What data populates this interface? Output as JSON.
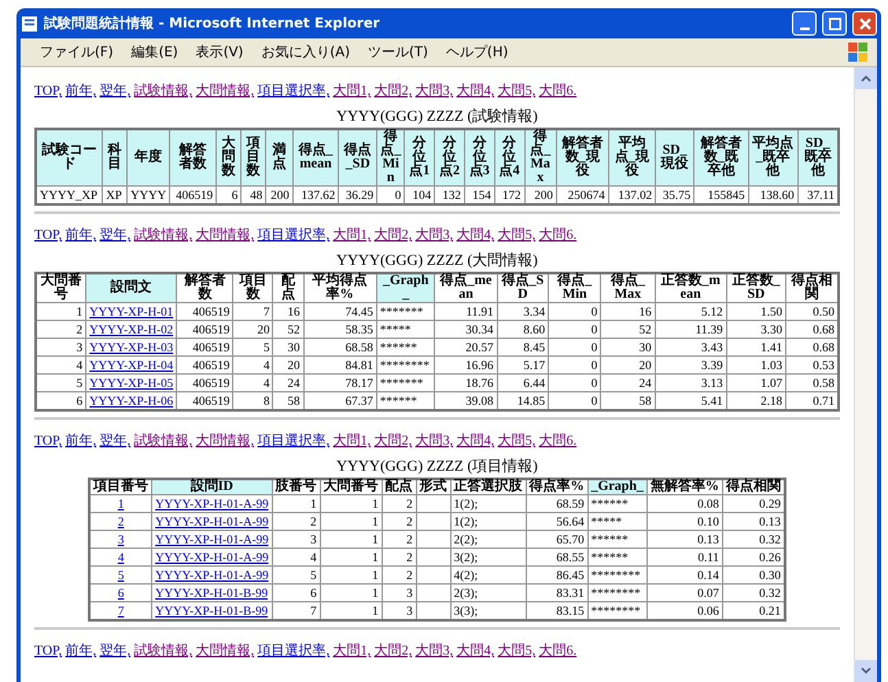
{
  "window": {
    "title": "試験問題統計情報 - Microsoft Internet Explorer"
  },
  "menu": [
    "ファイル(F)",
    "編集(E)",
    "表示(V)",
    "お気に入り(A)",
    "ツール(T)",
    "ヘルプ(H)"
  ],
  "sections": [
    {
      "nav": [
        {
          "text": "TOP,",
          "visited": false
        },
        {
          "text": "前年,",
          "visited": false
        },
        {
          "text": "翌年,",
          "visited": false
        },
        {
          "text": "試験情報,",
          "visited": true
        },
        {
          "text": "大問情報,",
          "visited": true
        },
        {
          "text": "項目選択率,",
          "visited": false
        },
        {
          "text": "大問1,",
          "visited": true
        },
        {
          "text": "大問2,",
          "visited": true
        },
        {
          "text": "大問3,",
          "visited": true
        },
        {
          "text": "大問4,",
          "visited": true
        },
        {
          "text": "大問5,",
          "visited": true
        },
        {
          "text": "大問6.",
          "visited": true
        }
      ],
      "caption": "YYYY(GGG) ZZZZ (試験情報)",
      "table": {
        "columns": [
          {
            "label": "試験コード",
            "highlighted": true,
            "kind": "text"
          },
          {
            "label": "科目",
            "highlighted": true,
            "kind": "text"
          },
          {
            "label": "年度",
            "highlighted": true,
            "kind": "text"
          },
          {
            "label": "解答者数",
            "highlighted": true,
            "kind": "number"
          },
          {
            "label": "大問数",
            "highlighted": true,
            "kind": "number"
          },
          {
            "label": "項目数",
            "highlighted": true,
            "kind": "number"
          },
          {
            "label": "満点",
            "highlighted": true,
            "kind": "number"
          },
          {
            "label": "得点_mean",
            "highlighted": true,
            "kind": "number"
          },
          {
            "label": "得点_SD",
            "highlighted": true,
            "kind": "number"
          },
          {
            "label": "得点_Min",
            "highlighted": true,
            "kind": "number"
          },
          {
            "label": "分位点1",
            "highlighted": true,
            "kind": "number"
          },
          {
            "label": "分位点2",
            "highlighted": true,
            "kind": "number"
          },
          {
            "label": "分位点3",
            "highlighted": true,
            "kind": "number"
          },
          {
            "label": "分位点4",
            "highlighted": true,
            "kind": "number"
          },
          {
            "label": "得点_Max",
            "highlighted": true,
            "kind": "number"
          },
          {
            "label": "解答者数_現役",
            "highlighted": true,
            "kind": "number"
          },
          {
            "label": "平均点_現役",
            "highlighted": true,
            "kind": "number"
          },
          {
            "label": "SD_現役",
            "highlighted": true,
            "kind": "number"
          },
          {
            "label": "解答者数_既卒他",
            "highlighted": true,
            "kind": "number"
          },
          {
            "label": "平均点_既卒他",
            "highlighted": true,
            "kind": "number"
          },
          {
            "label": "SD_既卒他",
            "highlighted": true,
            "kind": "number"
          }
        ],
        "rows": [
          [
            "YYYY_XP",
            "XP",
            "YYYY",
            "406519",
            "6",
            "48",
            "200",
            "137.62",
            "36.29",
            "0",
            "104",
            "132",
            "154",
            "172",
            "200",
            "250674",
            "137.02",
            "35.75",
            "155845",
            "138.60",
            "37.11"
          ]
        ]
      }
    },
    {
      "nav": [
        {
          "text": "TOP,",
          "visited": false
        },
        {
          "text": "前年,",
          "visited": false
        },
        {
          "text": "翌年,",
          "visited": false
        },
        {
          "text": "試験情報,",
          "visited": true
        },
        {
          "text": "大問情報,",
          "visited": true
        },
        {
          "text": "項目選択率,",
          "visited": false
        },
        {
          "text": "大問1,",
          "visited": true
        },
        {
          "text": "大問2,",
          "visited": true
        },
        {
          "text": "大問3,",
          "visited": true
        },
        {
          "text": "大問4,",
          "visited": true
        },
        {
          "text": "大問5,",
          "visited": true
        },
        {
          "text": "大問6.",
          "visited": true
        }
      ],
      "caption": "YYYY(GGG) ZZZZ (大問情報)",
      "table": {
        "columns": [
          {
            "label": "大問番号",
            "highlighted": false,
            "kind": "number"
          },
          {
            "label": "設問文",
            "highlighted": true,
            "kind": "link"
          },
          {
            "label": "解答者数",
            "highlighted": false,
            "kind": "number"
          },
          {
            "label": "項目数",
            "highlighted": false,
            "kind": "number"
          },
          {
            "label": "配点",
            "highlighted": false,
            "kind": "number"
          },
          {
            "label": "平均得点率%",
            "highlighted": false,
            "kind": "number"
          },
          {
            "label": "_Graph_",
            "highlighted": true,
            "kind": "text"
          },
          {
            "label": "得点_mean",
            "highlighted": false,
            "kind": "number"
          },
          {
            "label": "得点_SD",
            "highlighted": false,
            "kind": "number"
          },
          {
            "label": "得点_Min",
            "highlighted": false,
            "kind": "number"
          },
          {
            "label": "得点_Max",
            "highlighted": false,
            "kind": "number"
          },
          {
            "label": "正答数_mean",
            "highlighted": false,
            "kind": "number"
          },
          {
            "label": "正答数_SD",
            "highlighted": false,
            "kind": "number"
          },
          {
            "label": "得点相関",
            "highlighted": false,
            "kind": "number"
          }
        ],
        "rows": [
          [
            "1",
            "YYYY-XP-H-01",
            "406519",
            "7",
            "16",
            "74.45",
            "*******",
            "11.91",
            "3.34",
            "0",
            "16",
            "5.12",
            "1.50",
            "0.50"
          ],
          [
            "2",
            "YYYY-XP-H-02",
            "406519",
            "20",
            "52",
            "58.35",
            "*****",
            "30.34",
            "8.60",
            "0",
            "52",
            "11.39",
            "3.30",
            "0.68"
          ],
          [
            "3",
            "YYYY-XP-H-03",
            "406519",
            "5",
            "30",
            "68.58",
            "******",
            "20.57",
            "8.45",
            "0",
            "30",
            "3.43",
            "1.41",
            "0.68"
          ],
          [
            "4",
            "YYYY-XP-H-04",
            "406519",
            "4",
            "20",
            "84.81",
            "********",
            "16.96",
            "5.17",
            "0",
            "20",
            "3.39",
            "1.03",
            "0.53"
          ],
          [
            "5",
            "YYYY-XP-H-05",
            "406519",
            "4",
            "24",
            "78.17",
            "*******",
            "18.76",
            "6.44",
            "0",
            "24",
            "3.13",
            "1.07",
            "0.58"
          ],
          [
            "6",
            "YYYY-XP-H-06",
            "406519",
            "8",
            "58",
            "67.37",
            "******",
            "39.08",
            "14.85",
            "0",
            "58",
            "5.41",
            "2.18",
            "0.71"
          ]
        ]
      }
    },
    {
      "nav": [
        {
          "text": "TOP,",
          "visited": false
        },
        {
          "text": "前年,",
          "visited": false
        },
        {
          "text": "翌年,",
          "visited": false
        },
        {
          "text": "試験情報,",
          "visited": true
        },
        {
          "text": "大問情報,",
          "visited": true
        },
        {
          "text": "項目選択率,",
          "visited": false
        },
        {
          "text": "大問1,",
          "visited": true
        },
        {
          "text": "大問2,",
          "visited": true
        },
        {
          "text": "大問3,",
          "visited": true
        },
        {
          "text": "大問4,",
          "visited": true
        },
        {
          "text": "大問5,",
          "visited": true
        },
        {
          "text": "大問6.",
          "visited": true
        }
      ],
      "caption": "YYYY(GGG) ZZZZ (項目情報)",
      "table": {
        "columns": [
          {
            "label": "項目番号",
            "highlighted": false,
            "kind": "center-link"
          },
          {
            "label": "設問ID",
            "highlighted": true,
            "kind": "link"
          },
          {
            "label": "肢番号",
            "highlighted": false,
            "kind": "number"
          },
          {
            "label": "大問番号",
            "highlighted": false,
            "kind": "number"
          },
          {
            "label": "配点",
            "highlighted": false,
            "kind": "number"
          },
          {
            "label": "形式",
            "highlighted": false,
            "kind": "text"
          },
          {
            "label": "正答選択肢",
            "highlighted": false,
            "kind": "text"
          },
          {
            "label": "得点率%",
            "highlighted": false,
            "kind": "number"
          },
          {
            "label": "_Graph_",
            "highlighted": true,
            "kind": "text"
          },
          {
            "label": "無解答率%",
            "highlighted": false,
            "kind": "number"
          },
          {
            "label": "得点相関",
            "highlighted": false,
            "kind": "number"
          }
        ],
        "rows": [
          [
            "1",
            "YYYY-XP-H-01-A-99",
            "1",
            "1",
            "2",
            null,
            "1(2);",
            "68.59",
            "******",
            "0.08",
            "0.29"
          ],
          [
            "2",
            "YYYY-XP-H-01-A-99",
            "2",
            "1",
            "2",
            null,
            "1(2);",
            "56.64",
            "*****",
            "0.10",
            "0.13"
          ],
          [
            "3",
            "YYYY-XP-H-01-A-99",
            "3",
            "1",
            "2",
            null,
            "2(2);",
            "65.70",
            "******",
            "0.13",
            "0.32"
          ],
          [
            "4",
            "YYYY-XP-H-01-A-99",
            "4",
            "1",
            "2",
            null,
            "3(2);",
            "68.55",
            "******",
            "0.11",
            "0.26"
          ],
          [
            "5",
            "YYYY-XP-H-01-A-99",
            "5",
            "1",
            "2",
            null,
            "4(2);",
            "86.45",
            "********",
            "0.14",
            "0.30"
          ],
          [
            "6",
            "YYYY-XP-H-01-B-99",
            "6",
            "1",
            "3",
            null,
            "2(3);",
            "83.31",
            "********",
            "0.07",
            "0.32"
          ],
          [
            "7",
            "YYYY-XP-H-01-B-99",
            "7",
            "1",
            "3",
            null,
            "3(3);",
            "83.15",
            "********",
            "0.06",
            "0.21"
          ]
        ]
      }
    }
  ],
  "footer_nav": [
    {
      "text": "TOP,",
      "visited": false
    },
    {
      "text": "前年,",
      "visited": false
    },
    {
      "text": "翌年,",
      "visited": false
    },
    {
      "text": "試験情報,",
      "visited": true
    },
    {
      "text": "大問情報,",
      "visited": true
    },
    {
      "text": "項目選択率,",
      "visited": false
    },
    {
      "text": "大問1,",
      "visited": true
    },
    {
      "text": "大問2,",
      "visited": true
    },
    {
      "text": "大問3,",
      "visited": true
    },
    {
      "text": "大問4,",
      "visited": true
    },
    {
      "text": "大問5,",
      "visited": true
    },
    {
      "text": "大問6.",
      "visited": true
    }
  ]
}
